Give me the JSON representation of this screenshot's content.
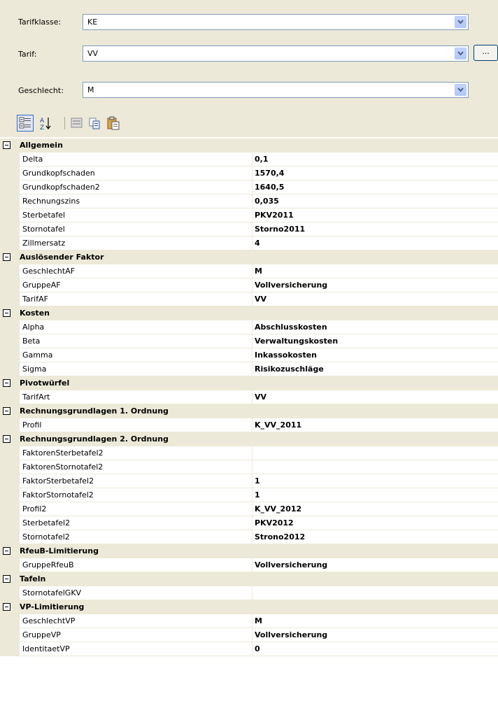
{
  "fields": {
    "tarifklasse": {
      "label": "Tarifklasse:",
      "value": "KE"
    },
    "tarif": {
      "label": "Tarif:",
      "value": "VV",
      "button": "..."
    },
    "geschlecht": {
      "label": "Geschlecht:",
      "value": "M"
    }
  },
  "toolbar": {
    "icons": [
      "categorized-icon",
      "alphabetical-sort-icon",
      "property-pages-icon",
      "copy-icon",
      "paste-icon"
    ]
  },
  "grid": {
    "sections": [
      {
        "name": "Allgemein",
        "rows": [
          [
            "Delta",
            "0,1"
          ],
          [
            "Grundkopfschaden",
            "1570,4"
          ],
          [
            "Grundkopfschaden2",
            "1640,5"
          ],
          [
            "Rechnungszins",
            "0,035"
          ],
          [
            "Sterbetafel",
            "PKV2011"
          ],
          [
            "Stornotafel",
            "Storno2011"
          ],
          [
            "Zillmersatz",
            "4"
          ]
        ]
      },
      {
        "name": "Auslösender Faktor",
        "rows": [
          [
            "GeschlechtAF",
            "M"
          ],
          [
            "GruppeAF",
            "Vollversicherung"
          ],
          [
            "TarifAF",
            "VV"
          ]
        ]
      },
      {
        "name": "Kosten",
        "rows": [
          [
            "Alpha",
            "Abschlusskosten"
          ],
          [
            "Beta",
            "Verwaltungskosten"
          ],
          [
            "Gamma",
            "Inkassokosten"
          ],
          [
            "Sigma",
            "Risikozuschläge"
          ]
        ]
      },
      {
        "name": "Pivotwürfel",
        "rows": [
          [
            "TarifArt",
            "VV"
          ]
        ]
      },
      {
        "name": "Rechnungsgrundlagen 1. Ordnung",
        "rows": [
          [
            "Profil",
            "K_VV_2011"
          ]
        ]
      },
      {
        "name": "Rechnungsgrundlagen 2. Ordnung",
        "rows": [
          [
            "FaktorenSterbetafel2",
            ""
          ],
          [
            "FaktorenStornotafel2",
            ""
          ],
          [
            "FaktorSterbetafel2",
            "1"
          ],
          [
            "FaktorStornotafel2",
            "1"
          ],
          [
            "Profil2",
            "K_VV_2012"
          ],
          [
            "Sterbetafel2",
            "PKV2012"
          ],
          [
            "Stornotafel2",
            "Strono2012"
          ]
        ]
      },
      {
        "name": "RfeuB-Limitierung",
        "rows": [
          [
            "GruppeRfeuB",
            "Vollversicherung"
          ]
        ]
      },
      {
        "name": "Tafeln",
        "rows": [
          [
            "StornotafelGKV",
            ""
          ]
        ]
      },
      {
        "name": "VP-Limitierung",
        "rows": [
          [
            "GeschlechtVP",
            "M"
          ],
          [
            "GruppeVP",
            "Vollversicherung"
          ],
          [
            "IdentitaetVP",
            "0"
          ]
        ]
      }
    ]
  }
}
